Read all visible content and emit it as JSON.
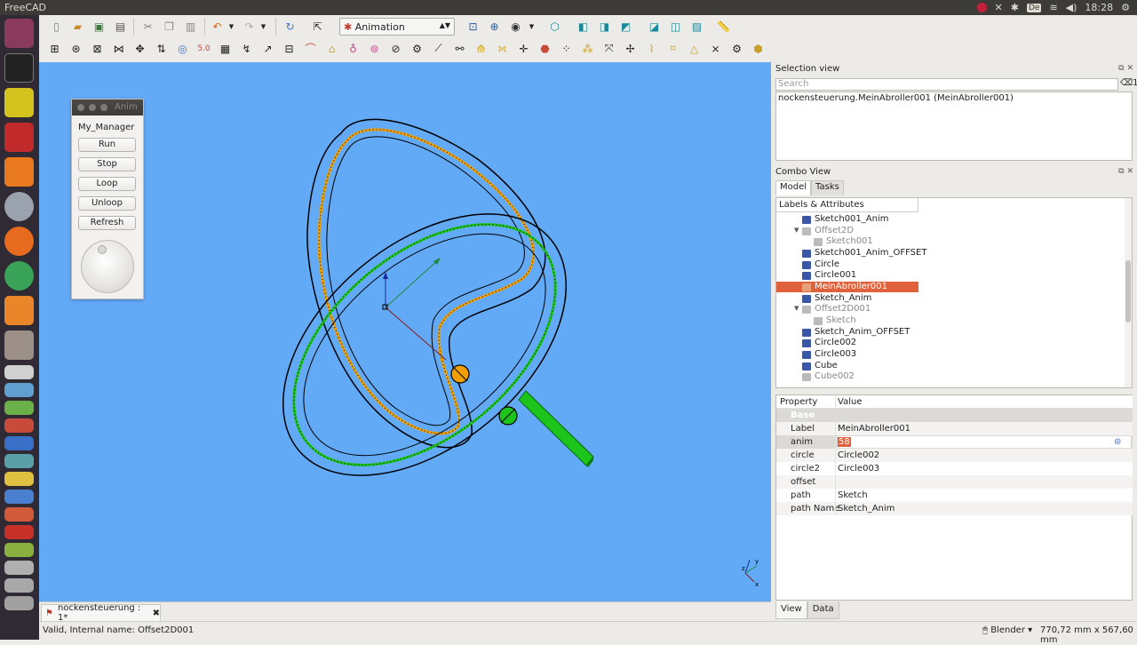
{
  "topbar": {
    "title": "FreeCAD",
    "keyboard": "De",
    "time": "18:28"
  },
  "toolbar": {
    "workbench": "Animation"
  },
  "anim_dialog": {
    "title": "Anim",
    "manager_label": "My_Manager",
    "buttons": [
      "Run",
      "Stop",
      "Loop",
      "Unloop",
      "Refresh"
    ]
  },
  "selection_view": {
    "title": "Selection view",
    "search_placeholder": "Search",
    "count": "1",
    "entry": "nockensteuerung.MeinAbroller001 (MeinAbroller001)"
  },
  "combo_view": {
    "title": "Combo View",
    "tabs": [
      "Model",
      "Tasks"
    ],
    "tree_header": "Labels & Attributes",
    "tree_items": [
      {
        "label": "Sketch001_Anim",
        "state": "normal",
        "icon": "sketch-icon",
        "color": "#3a56a6"
      },
      {
        "label": "Offset2D",
        "state": "dim",
        "icon": "offset-icon",
        "color": "#9a9a9a"
      },
      {
        "label": "Sketch001",
        "state": "dim",
        "icon": "sketch-icon",
        "color": "#9a9a9a"
      },
      {
        "label": "Sketch001_Anim_OFFSET",
        "state": "normal",
        "icon": "sketch-icon",
        "color": "#3a56a6"
      },
      {
        "label": "Circle",
        "state": "normal",
        "icon": "circle-icon",
        "color": "#3a56a6"
      },
      {
        "label": "Circle001",
        "state": "normal",
        "icon": "circle-icon",
        "color": "#3a56a6"
      },
      {
        "label": "MeinAbroller001",
        "state": "selected",
        "icon": "abroller-icon",
        "color": "#e8a07a"
      },
      {
        "label": "Sketch_Anim",
        "state": "normal",
        "icon": "sketch-icon",
        "color": "#3a56a6"
      },
      {
        "label": "Offset2D001",
        "state": "dim",
        "icon": "offset-icon",
        "color": "#9a9a9a"
      },
      {
        "label": "Sketch",
        "state": "dim",
        "icon": "sketch-icon",
        "color": "#9a9a9a"
      },
      {
        "label": "Sketch_Anim_OFFSET",
        "state": "normal",
        "icon": "sketch-icon",
        "color": "#3a56a6"
      },
      {
        "label": "Circle002",
        "state": "normal",
        "icon": "circle-icon",
        "color": "#3a56a6"
      },
      {
        "label": "Circle003",
        "state": "normal",
        "icon": "circle-icon",
        "color": "#3a56a6"
      },
      {
        "label": "Cube",
        "state": "normal",
        "icon": "cube-icon",
        "color": "#3a56a6"
      },
      {
        "label": "Cube002",
        "state": "dim",
        "icon": "cube-icon",
        "color": "#9a9a9a"
      }
    ]
  },
  "properties": {
    "headers": [
      "Property",
      "Value"
    ],
    "group": "Base",
    "rows": [
      {
        "key": "Label",
        "value": "MeinAbroller001"
      },
      {
        "key": "anim",
        "value": "58"
      },
      {
        "key": "circle",
        "value": "Circle002"
      },
      {
        "key": "circle2",
        "value": "Circle003"
      },
      {
        "key": "offset",
        "value": ""
      },
      {
        "key": "path",
        "value": "Sketch"
      },
      {
        "key": "path Name",
        "value": "Sketch_Anim"
      }
    ],
    "view_tabs": [
      "View",
      "Data"
    ]
  },
  "document_tab": {
    "label": "nockensteuerung : 1*"
  },
  "statusbar": {
    "message": "Valid, Internal name: Offset2D001",
    "nav_style": "Blender",
    "dimensions": "770,72 mm x 567,60 mm"
  },
  "colors": {
    "viewport_bg": "#62a9f6",
    "cam_orange": "#f0a000",
    "roller_green": "#1cc41c",
    "selection": "#e0623c"
  }
}
